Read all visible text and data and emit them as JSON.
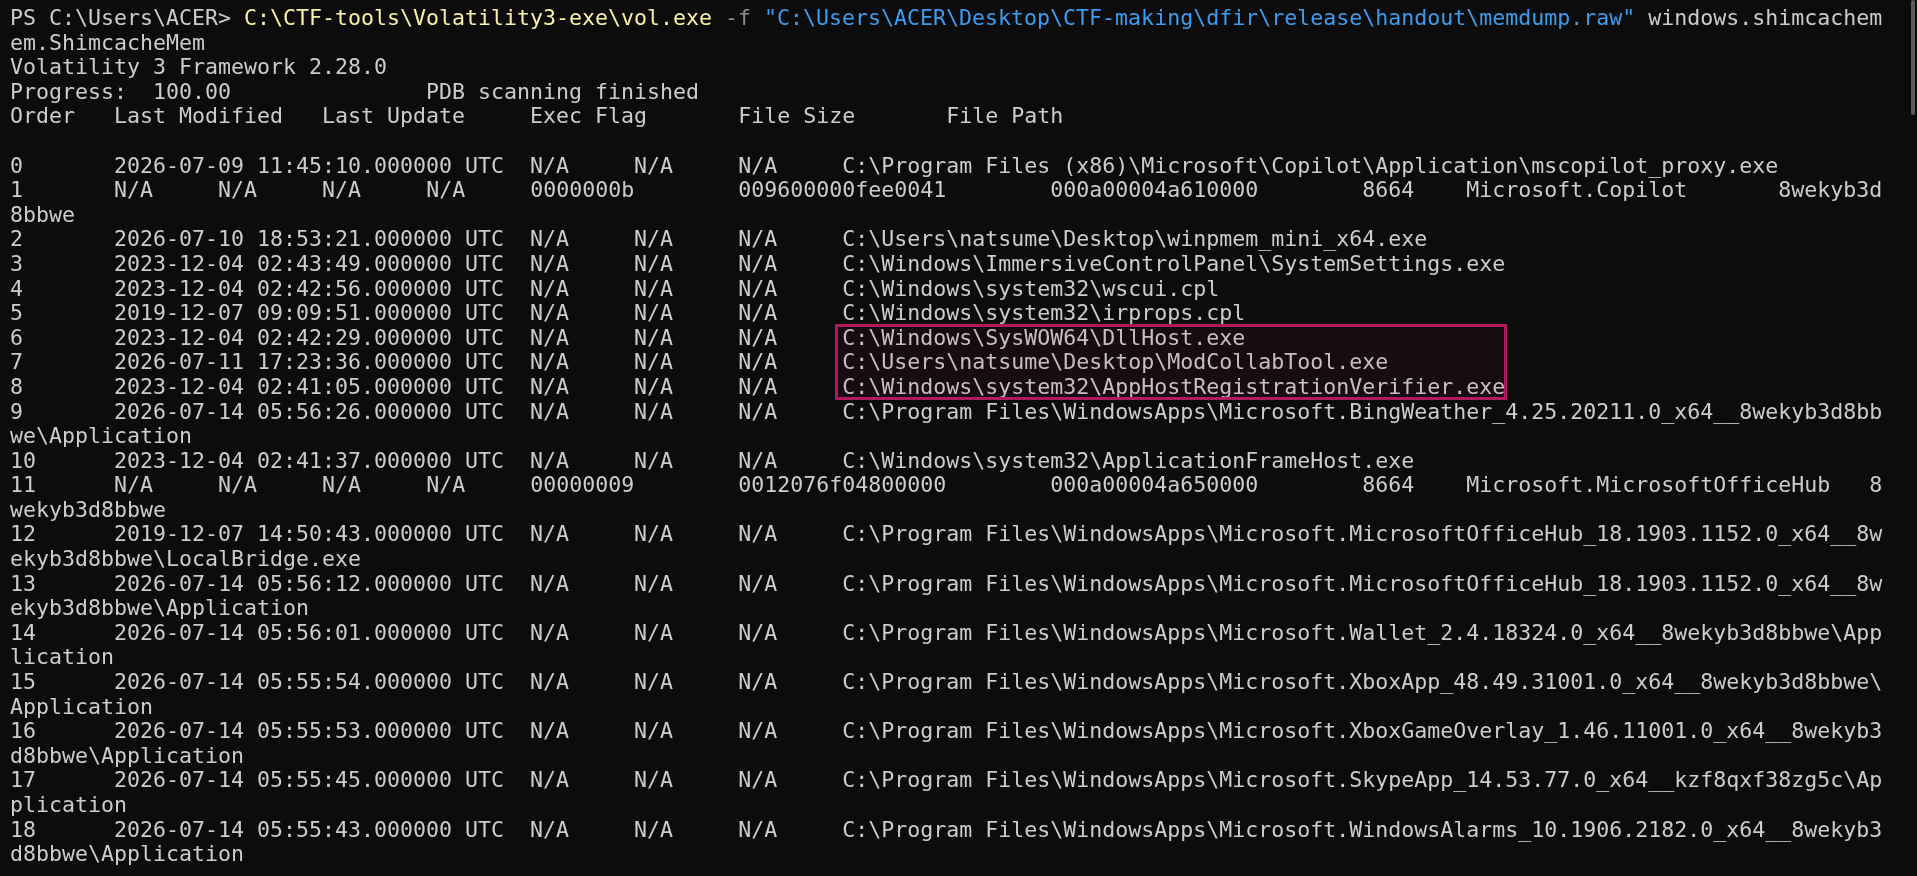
{
  "terminal": {
    "prompt": "PS C:\\Users\\ACER>",
    "command": [
      {
        "kind": "executable",
        "text": "C:\\CTF-tools\\Volatility3-exe\\vol.exe"
      },
      {
        "kind": "parameter",
        "text": "-f"
      },
      {
        "kind": "string",
        "text": "\"C:\\Users\\ACER\\Desktop\\CTF-making\\dfir\\release\\handout\\memdump.raw\""
      },
      {
        "kind": "argument",
        "text": "windows.shimcachem"
      }
    ],
    "command_continuation": "em.ShimcacheMem",
    "banner": "Volatility 3 Framework 2.28.0",
    "progress": {
      "label": "Progress:",
      "value": "100.00",
      "status": "PDB scanning finished"
    },
    "header_line": [
      "Order",
      "Last Modified",
      "Last Update",
      "Exec Flag",
      "File Size",
      "File Path"
    ],
    "rows": [
      {
        "highlighted": false,
        "cells": [
          "0",
          "2026-07-09 11:45:10.000000 UTC",
          "N/A",
          "N/A",
          "N/A",
          "C:\\Program Files (x86)\\Microsoft\\Copilot\\Application\\mscopilot_proxy.exe"
        ]
      },
      {
        "highlighted": false,
        "cells": [
          "1",
          "N/A",
          "N/A",
          "N/A",
          "N/A",
          "0000000b",
          "009600000fee0041",
          "000a00004a610000",
          "8664",
          "Microsoft.Copilot",
          "8wekyb3d"
        ],
        "continuation": "8bbwe"
      },
      {
        "highlighted": false,
        "cells": [
          "2",
          "2026-07-10 18:53:21.000000 UTC",
          "N/A",
          "N/A",
          "N/A",
          "C:\\Users\\natsume\\Desktop\\winpmem_mini_x64.exe"
        ]
      },
      {
        "highlighted": false,
        "cells": [
          "3",
          "2023-12-04 02:43:49.000000 UTC",
          "N/A",
          "N/A",
          "N/A",
          "C:\\Windows\\ImmersiveControlPanel\\SystemSettings.exe"
        ]
      },
      {
        "highlighted": false,
        "cells": [
          "4",
          "2023-12-04 02:42:56.000000 UTC",
          "N/A",
          "N/A",
          "N/A",
          "C:\\Windows\\system32\\wscui.cpl"
        ]
      },
      {
        "highlighted": false,
        "cells": [
          "5",
          "2019-12-07 09:09:51.000000 UTC",
          "N/A",
          "N/A",
          "N/A",
          "C:\\Windows\\system32\\irprops.cpl"
        ]
      },
      {
        "highlighted": true,
        "cells": [
          "6",
          "2023-12-04 02:42:29.000000 UTC",
          "N/A",
          "N/A",
          "N/A",
          "C:\\Windows\\SysWOW64\\DllHost.exe"
        ]
      },
      {
        "highlighted": true,
        "cells": [
          "7",
          "2026-07-11 17:23:36.000000 UTC",
          "N/A",
          "N/A",
          "N/A",
          "C:\\Users\\natsume\\Desktop\\ModCollabTool.exe"
        ]
      },
      {
        "highlighted": true,
        "cells": [
          "8",
          "2023-12-04 02:41:05.000000 UTC",
          "N/A",
          "N/A",
          "N/A",
          "C:\\Windows\\system32\\AppHostRegistrationVerifier.exe"
        ]
      },
      {
        "highlighted": false,
        "cells": [
          "9",
          "2026-07-14 05:56:26.000000 UTC",
          "N/A",
          "N/A",
          "N/A",
          "C:\\Program Files\\WindowsApps\\Microsoft.BingWeather_4.25.20211.0_x64__8wekyb3d8bb"
        ],
        "continuation": "we\\Application"
      },
      {
        "highlighted": false,
        "cells": [
          "10",
          "2023-12-04 02:41:37.000000 UTC",
          "N/A",
          "N/A",
          "N/A",
          "C:\\Windows\\system32\\ApplicationFrameHost.exe"
        ]
      },
      {
        "highlighted": false,
        "cells": [
          "11",
          "N/A",
          "N/A",
          "N/A",
          "N/A",
          "00000009",
          "0012076f04800000",
          "000a00004a650000",
          "8664",
          "Microsoft.MicrosoftOfficeHub",
          "8"
        ],
        "continuation": "wekyb3d8bbwe"
      },
      {
        "highlighted": false,
        "cells": [
          "12",
          "2019-12-07 14:50:43.000000 UTC",
          "N/A",
          "N/A",
          "N/A",
          "C:\\Program Files\\WindowsApps\\Microsoft.MicrosoftOfficeHub_18.1903.1152.0_x64__8w"
        ],
        "continuation": "ekyb3d8bbwe\\LocalBridge.exe"
      },
      {
        "highlighted": false,
        "cells": [
          "13",
          "2026-07-14 05:56:12.000000 UTC",
          "N/A",
          "N/A",
          "N/A",
          "C:\\Program Files\\WindowsApps\\Microsoft.MicrosoftOfficeHub_18.1903.1152.0_x64__8w"
        ],
        "continuation": "ekyb3d8bbwe\\Application"
      },
      {
        "highlighted": false,
        "cells": [
          "14",
          "2026-07-14 05:56:01.000000 UTC",
          "N/A",
          "N/A",
          "N/A",
          "C:\\Program Files\\WindowsApps\\Microsoft.Wallet_2.4.18324.0_x64__8wekyb3d8bbwe\\App"
        ],
        "continuation": "lication"
      },
      {
        "highlighted": false,
        "cells": [
          "15",
          "2026-07-14 05:55:54.000000 UTC",
          "N/A",
          "N/A",
          "N/A",
          "C:\\Program Files\\WindowsApps\\Microsoft.XboxApp_48.49.31001.0_x64__8wekyb3d8bbwe\\"
        ],
        "continuation": "Application"
      },
      {
        "highlighted": false,
        "cells": [
          "16",
          "2026-07-14 05:55:53.000000 UTC",
          "N/A",
          "N/A",
          "N/A",
          "C:\\Program Files\\WindowsApps\\Microsoft.XboxGameOverlay_1.46.11001.0_x64__8wekyb3"
        ],
        "continuation": "d8bbwe\\Application"
      },
      {
        "highlighted": false,
        "cells": [
          "17",
          "2026-07-14 05:55:45.000000 UTC",
          "N/A",
          "N/A",
          "N/A",
          "C:\\Program Files\\WindowsApps\\Microsoft.SkypeApp_14.53.77.0_x64__kzf8qxf38zg5c\\Ap"
        ],
        "continuation": "plication"
      },
      {
        "highlighted": false,
        "cells": [
          "18",
          "2026-07-14 05:55:43.000000 UTC",
          "N/A",
          "N/A",
          "N/A",
          "C:\\Program Files\\WindowsApps\\Microsoft.WindowsAlarms_10.1906.2182.0_x64__8wekyb3"
        ],
        "continuation": "d8bbwe\\Application"
      }
    ]
  }
}
